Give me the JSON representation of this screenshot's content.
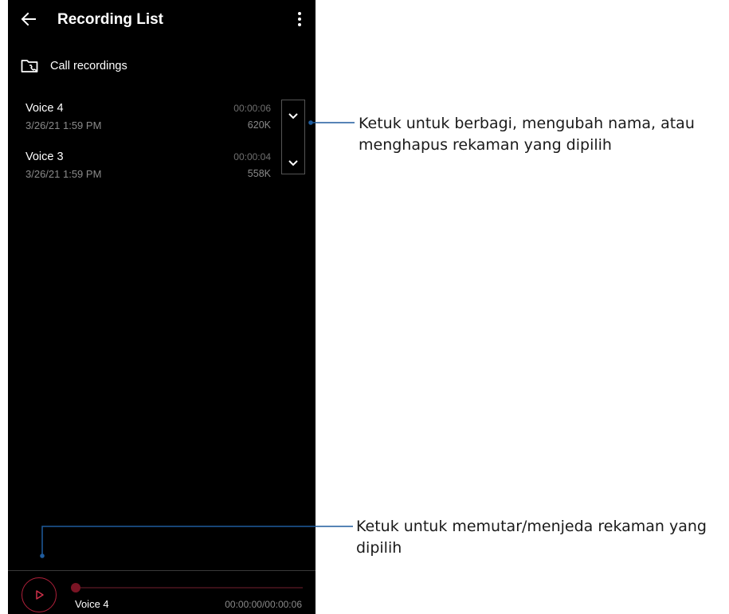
{
  "header": {
    "title": "Recording List",
    "back_icon": "back-arrow-icon",
    "more_icon": "more-vert-icon"
  },
  "folder": {
    "label": "Call recordings",
    "icon": "folder-call-icon"
  },
  "recordings": [
    {
      "name": "Voice 4",
      "date": "3/26/21 1:59 PM",
      "duration": "00:00:06",
      "size": "620K"
    },
    {
      "name": "Voice 3",
      "date": "3/26/21 1:59 PM",
      "duration": "00:00:04",
      "size": "558K"
    }
  ],
  "player": {
    "track_name": "Voice 4",
    "time": "00:00:00/00:00:06",
    "progress": 0,
    "accent_color": "#b0203a"
  },
  "annotations": {
    "expand": {
      "line1": "Ketuk untuk berbagi, mengubah nama, atau",
      "line2": "menghapus rekaman yang dipilih"
    },
    "play": {
      "line1": "Ketuk untuk memutar/menjeda rekaman yang",
      "line2": "dipilih"
    },
    "line_color": "#1f5c9e"
  }
}
